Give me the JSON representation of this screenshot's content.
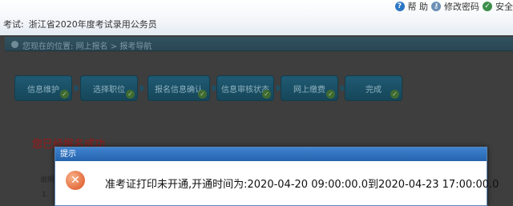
{
  "header": {
    "exam_prefix": "考试:",
    "exam_name": "浙江省2020年度考试录用公务员",
    "links": {
      "help": "帮 助",
      "change_password": "修改密码",
      "safe": "安全"
    }
  },
  "breadcrumb": {
    "parts": [
      "您现在的位置:",
      "网上报名",
      ">",
      "报考导航"
    ]
  },
  "steps": [
    {
      "label": "信息维护"
    },
    {
      "label": "选择职位"
    },
    {
      "label": "报名信息确认"
    },
    {
      "label": "信息审核状态"
    },
    {
      "label": "网上缴费"
    },
    {
      "label": "完成"
    }
  ],
  "main": {
    "success_text": "您已经报名成功",
    "note_label": "说明",
    "item1": "1."
  },
  "dialog": {
    "title": "提示",
    "message": "准考证打印未开通,开通时间为:2020-04-20 09:00:00.0到2020-04-23 17:00:00.0"
  }
}
